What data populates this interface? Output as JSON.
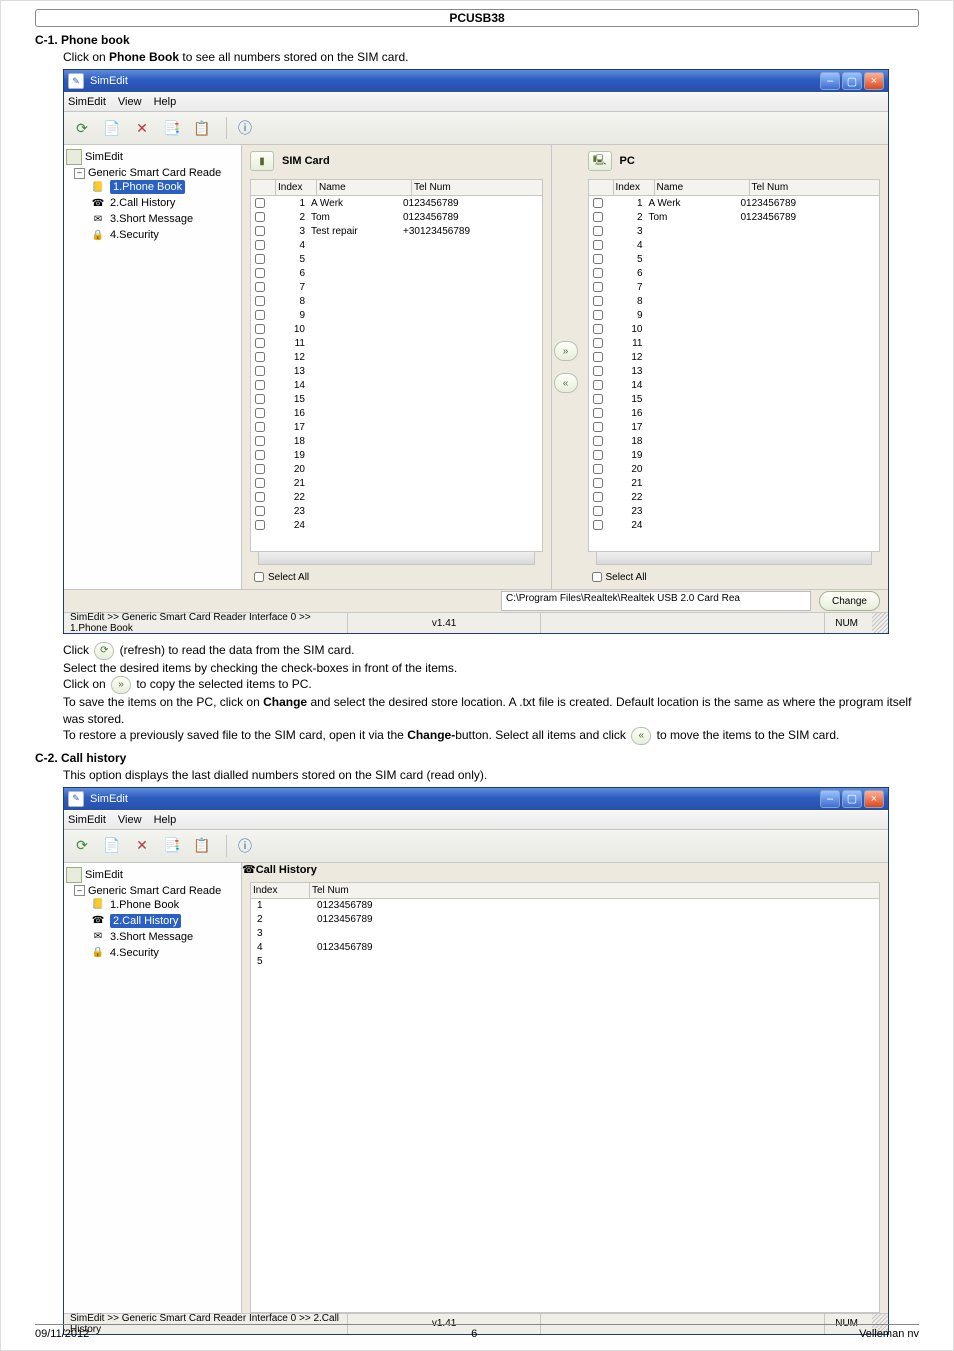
{
  "doc_header": "PCUSB38",
  "section_c1": {
    "title": "C-1. Phone book",
    "intro_pre": "Click on ",
    "intro_bold": "Phone Book",
    "intro_post": " to see all numbers stored on the SIM card."
  },
  "win1": {
    "title": "SimEdit",
    "menu": [
      "SimEdit",
      "View",
      "Help"
    ],
    "tree": {
      "root": "SimEdit",
      "reader": "Generic Smart Card Reade",
      "leaves": [
        "1.Phone Book",
        "2.Call History",
        "3.Short Message",
        "4.Security"
      ],
      "active_index": 0
    },
    "pane_left_caption": "SIM Card",
    "pane_right_caption": "PC",
    "cols": {
      "index": "Index",
      "name": "Name",
      "tel": "Tel Num"
    },
    "sim_rows": [
      {
        "i": 1,
        "n": "A Werk",
        "t": "0123456789"
      },
      {
        "i": 2,
        "n": "Tom",
        "t": "0123456789"
      },
      {
        "i": 3,
        "n": "Test repair",
        "t": "+30123456789"
      },
      {
        "i": 4,
        "n": "",
        "t": ""
      },
      {
        "i": 5,
        "n": "",
        "t": ""
      },
      {
        "i": 6,
        "n": "",
        "t": ""
      },
      {
        "i": 7,
        "n": "",
        "t": ""
      },
      {
        "i": 8,
        "n": "",
        "t": ""
      },
      {
        "i": 9,
        "n": "",
        "t": ""
      },
      {
        "i": 10,
        "n": "",
        "t": ""
      },
      {
        "i": 11,
        "n": "",
        "t": ""
      },
      {
        "i": 12,
        "n": "",
        "t": ""
      },
      {
        "i": 13,
        "n": "",
        "t": ""
      },
      {
        "i": 14,
        "n": "",
        "t": ""
      },
      {
        "i": 15,
        "n": "",
        "t": ""
      },
      {
        "i": 16,
        "n": "",
        "t": ""
      },
      {
        "i": 17,
        "n": "",
        "t": ""
      },
      {
        "i": 18,
        "n": "",
        "t": ""
      },
      {
        "i": 19,
        "n": "",
        "t": ""
      },
      {
        "i": 20,
        "n": "",
        "t": ""
      },
      {
        "i": 21,
        "n": "",
        "t": ""
      },
      {
        "i": 22,
        "n": "",
        "t": ""
      },
      {
        "i": 23,
        "n": "",
        "t": ""
      },
      {
        "i": 24,
        "n": "",
        "t": ""
      }
    ],
    "pc_rows": [
      {
        "i": 1,
        "n": "A Werk",
        "t": "0123456789"
      },
      {
        "i": 2,
        "n": "Tom",
        "t": "0123456789"
      },
      {
        "i": 3,
        "n": "",
        "t": ""
      },
      {
        "i": 4,
        "n": "",
        "t": ""
      },
      {
        "i": 5,
        "n": "",
        "t": ""
      },
      {
        "i": 6,
        "n": "",
        "t": ""
      },
      {
        "i": 7,
        "n": "",
        "t": ""
      },
      {
        "i": 8,
        "n": "",
        "t": ""
      },
      {
        "i": 9,
        "n": "",
        "t": ""
      },
      {
        "i": 10,
        "n": "",
        "t": ""
      },
      {
        "i": 11,
        "n": "",
        "t": ""
      },
      {
        "i": 12,
        "n": "",
        "t": ""
      },
      {
        "i": 13,
        "n": "",
        "t": ""
      },
      {
        "i": 14,
        "n": "",
        "t": ""
      },
      {
        "i": 15,
        "n": "",
        "t": ""
      },
      {
        "i": 16,
        "n": "",
        "t": ""
      },
      {
        "i": 17,
        "n": "",
        "t": ""
      },
      {
        "i": 18,
        "n": "",
        "t": ""
      },
      {
        "i": 19,
        "n": "",
        "t": ""
      },
      {
        "i": 20,
        "n": "",
        "t": ""
      },
      {
        "i": 21,
        "n": "",
        "t": ""
      },
      {
        "i": 22,
        "n": "",
        "t": ""
      },
      {
        "i": 23,
        "n": "",
        "t": ""
      },
      {
        "i": 24,
        "n": "",
        "t": ""
      }
    ],
    "select_all": "Select All",
    "path": "C:\\Program Files\\Realtek\\Realtek USB 2.0 Card Rea",
    "change": "Change",
    "status_path": "SimEdit  >>  Generic Smart Card Reader Interface 0  >>  1.Phone Book",
    "status_ver": "v1.41",
    "status_num": "NUM"
  },
  "c1_after": {
    "l1a": "Click ",
    "l1b": " (refresh) to read the data from the SIM card.",
    "l2": "Select the desired items by checking the check-boxes in front of the items.",
    "l3a": "Click on ",
    "l3b": " to copy the selected items to PC.",
    "l4a": "To save the items on the PC, click on ",
    "l4bold": "Change",
    "l4b": " and select the desired store location. A .txt file is created. Default location is the same as where the program itself was stored.",
    "l5a": "To restore a previously saved file to the SIM card, open it via the ",
    "l5bold": "Change-",
    "l5b": "button. Select all items and click ",
    "l5c": " to move the items to the SIM card."
  },
  "section_c2": {
    "title": "C-2. Call history",
    "intro": "This option displays the last dialled numbers stored on the SIM card (read only)."
  },
  "win2": {
    "title": "SimEdit",
    "menu": [
      "SimEdit",
      "View",
      "Help"
    ],
    "tree": {
      "root": "SimEdit",
      "reader": "Generic Smart Card Reade",
      "leaves": [
        "1.Phone Book",
        "2.Call History",
        "3.Short Message",
        "4.Security"
      ],
      "active_index": 1
    },
    "caption": "Call History",
    "cols": {
      "index": "Index",
      "tel": "Tel Num"
    },
    "rows": [
      {
        "i": 1,
        "t": "0123456789"
      },
      {
        "i": 2,
        "t": "0123456789"
      },
      {
        "i": 3,
        "t": ""
      },
      {
        "i": 4,
        "t": "0123456789"
      },
      {
        "i": 5,
        "t": ""
      }
    ],
    "status_path": "SimEdit  >>  Generic Smart Card Reader Interface 0  >>  2.Call History",
    "status_ver": "v1.41",
    "status_num": "NUM"
  },
  "footer": {
    "date": "09/11/2012",
    "page": "6",
    "company": "Velleman nv"
  }
}
